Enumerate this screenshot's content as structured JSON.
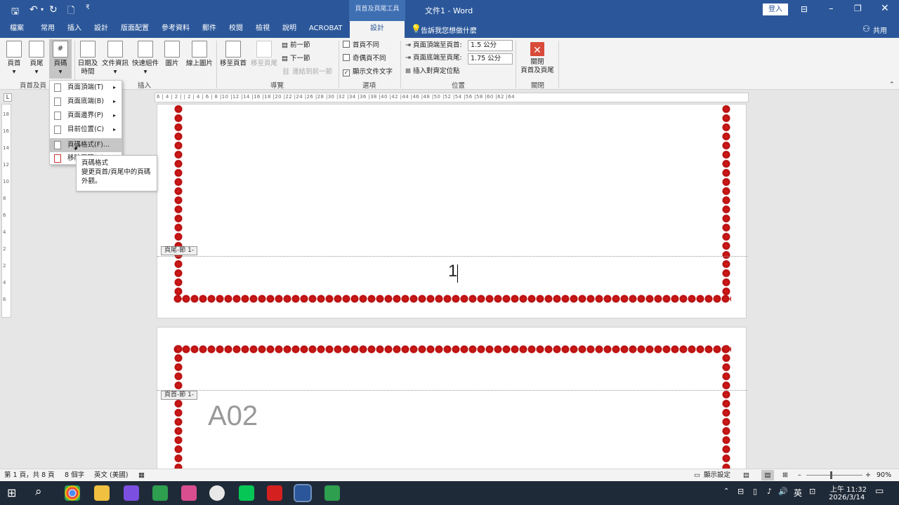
{
  "titlebar": {
    "context_group": "頁首及頁尾工具",
    "title": "文件1  -  Word",
    "signin": "登入"
  },
  "tabs": [
    "檔案",
    "常用",
    "插入",
    "設計",
    "版面配置",
    "參考資料",
    "郵件",
    "校閱",
    "檢視",
    "說明",
    "ACROBAT",
    "設計"
  ],
  "tell_me": "告訴我您想做什麼",
  "share": "共用",
  "ribbon": {
    "header": "頁首",
    "footer": "頁尾",
    "page_number": "頁碼",
    "group_hf": "頁首及頁",
    "date_time_1": "日期及",
    "date_time_2": "時間",
    "doc_info": "文件資訊",
    "quick_parts": "快速組件",
    "pictures": "圖片",
    "online_pictures": "線上圖片",
    "group_insert": "插入",
    "go_header": "移至頁首",
    "go_footer": "移至頁尾",
    "prev": "前一節",
    "next": "下一節",
    "link_prev": "連結到前一節",
    "group_nav": "導覽",
    "diff_first": "首頁不同",
    "diff_odd_even": "奇偶頁不同",
    "show_text": "顯示文件文字",
    "group_options": "選項",
    "header_from_top": "頁面頂端至頁首:",
    "header_val": "1.5 公分",
    "footer_from_bottom": "頁面底端至頁尾:",
    "footer_val": "1.75 公分",
    "insert_align_tab": "插入對齊定位點",
    "group_position": "位置",
    "close_1": "關閉",
    "close_2": "頁首及頁尾",
    "group_close": "關閉"
  },
  "menu": {
    "items": [
      "頁面頂端(T)",
      "頁面底端(B)",
      "頁面邊界(P)",
      "目前位置(C)",
      "頁碼格式(F)...",
      "移除頁碼(R)"
    ]
  },
  "tooltip": {
    "title": "頁碼格式",
    "desc": "變更頁首/頁尾中的頁碼外觀。"
  },
  "ruler_h": "6 | 4 | 2 |   | 2 | 4 | 6 | 8 |10 |12 |14 |16 |18 |20 |22 |24 |26 |28 |30 |32 |34 |36 |38 |40 |42 |44 |46 |48 |50 |52 |54 |56 |58 |60 |62 |64",
  "ruler_v": "18 16 14 12 10 8 6 4 2 2 4 6",
  "doc": {
    "footer_tag": "頁尾-節 1-",
    "page_number": "1",
    "header_tag": "頁首-節 1-",
    "body_text": "A02"
  },
  "status": {
    "page": "第 1 頁，共 8 頁",
    "words": "8 個字",
    "lang": "英文 (美國)",
    "display": "顯示設定",
    "zoom": "90%"
  },
  "taskbar": {
    "ime": "英",
    "time": "上午 11:32",
    "date": "2026/3/14"
  },
  "colors": {
    "word_blue": "#2b579a",
    "border_red": "#c81414"
  }
}
